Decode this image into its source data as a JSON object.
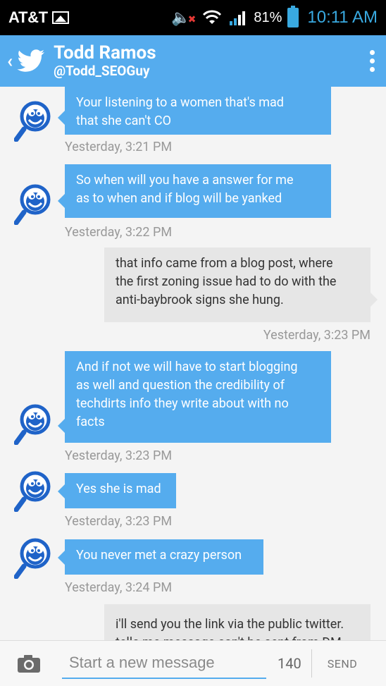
{
  "status_bar": {
    "carrier": "AT&T",
    "battery": "81%",
    "time": "10:11 AM"
  },
  "header": {
    "name": "Todd Ramos",
    "handle": "@Todd_SEOGuy"
  },
  "messages": [
    {
      "direction": "in",
      "lines": [
        "Your listening to a women that's mad",
        "that she can't CO"
      ],
      "time": "Yesterday, 3:21 PM"
    },
    {
      "direction": "in",
      "lines": [
        "So when will you have a answer for me",
        "as to when and if blog will be yanked"
      ],
      "time": "Yesterday, 3:22 PM"
    },
    {
      "direction": "out",
      "lines": [
        "that info came from a blog post, where",
        "the first zoning issue had to do with the",
        "anti-baybrook signs she hung."
      ],
      "time": "Yesterday, 3:23 PM"
    },
    {
      "direction": "in",
      "lines": [
        "And if not we will have to start blogging",
        "as well and question the credibility of",
        "techdirts info they write about with no",
        "facts"
      ],
      "time": "Yesterday, 3:23 PM"
    },
    {
      "direction": "in",
      "lines": [
        "Yes she is mad"
      ],
      "time": "Yesterday, 3:23 PM"
    },
    {
      "direction": "in",
      "lines": [
        "You never met a crazy person"
      ],
      "time": "Yesterday, 3:24 PM"
    },
    {
      "direction": "out",
      "lines": [
        "i'll send you the link via the public twitter.",
        "tells me message can't be sent from DM"
      ],
      "time": ""
    }
  ],
  "composer": {
    "placeholder": "Start a new message",
    "char_count": "140",
    "send_label": "SEND"
  },
  "colors": {
    "accent": "#55acee",
    "outgoing_bubble": "#e6e6e6",
    "clock": "#39a9e0"
  }
}
